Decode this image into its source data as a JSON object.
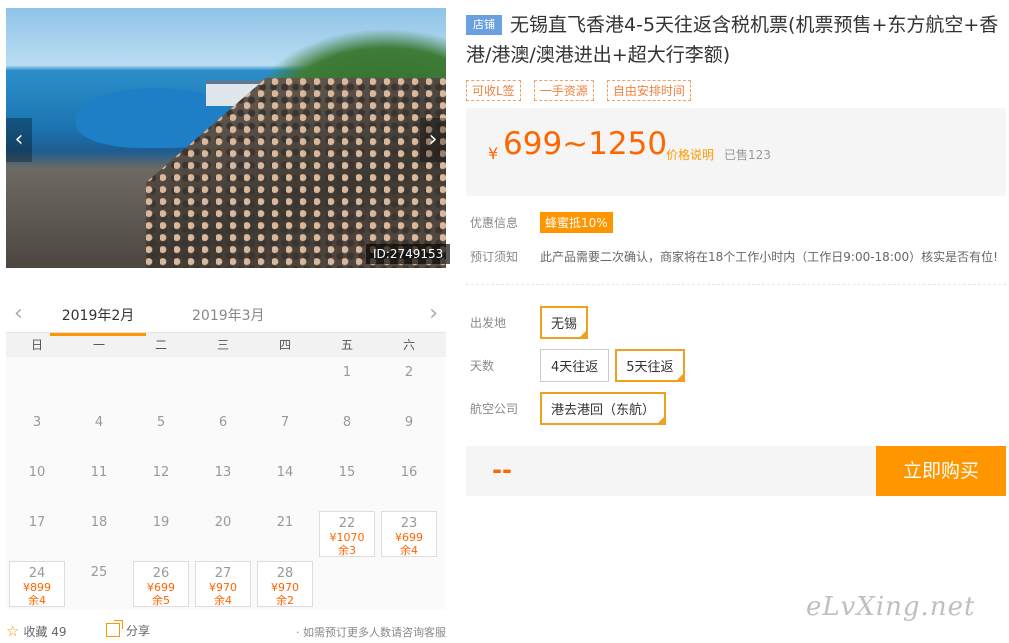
{
  "gallery": {
    "image_id": "ID:2749153",
    "prev": "‹",
    "next": "›"
  },
  "calendar": {
    "prev": "‹",
    "next": "›",
    "active_month": "2019年2月",
    "next_month": "2019年3月",
    "weekdays": [
      "日",
      "一",
      "二",
      "三",
      "四",
      "五",
      "六"
    ],
    "days": [
      {
        "d": ""
      },
      {
        "d": ""
      },
      {
        "d": ""
      },
      {
        "d": ""
      },
      {
        "d": ""
      },
      {
        "d": "1"
      },
      {
        "d": "2"
      },
      {
        "d": "3"
      },
      {
        "d": "4"
      },
      {
        "d": "5"
      },
      {
        "d": "6"
      },
      {
        "d": "7"
      },
      {
        "d": "8"
      },
      {
        "d": "9"
      },
      {
        "d": "10"
      },
      {
        "d": "11"
      },
      {
        "d": "12"
      },
      {
        "d": "13"
      },
      {
        "d": "14"
      },
      {
        "d": "15"
      },
      {
        "d": "16"
      },
      {
        "d": "17"
      },
      {
        "d": "18"
      },
      {
        "d": "19"
      },
      {
        "d": "20"
      },
      {
        "d": "21"
      },
      {
        "d": "22",
        "price": "¥1070",
        "stock": "余3"
      },
      {
        "d": "23",
        "price": "¥699",
        "stock": "余4"
      },
      {
        "d": "24",
        "price": "¥899",
        "stock": "余4"
      },
      {
        "d": "25"
      },
      {
        "d": "26",
        "price": "¥699",
        "stock": "余5"
      },
      {
        "d": "27",
        "price": "¥970",
        "stock": "余4"
      },
      {
        "d": "28",
        "price": "¥970",
        "stock": "余2"
      }
    ]
  },
  "footer": {
    "favorite_label": "收藏 49",
    "share_label": "分享",
    "note": "· 如需预订更多人数请咨询客服"
  },
  "product": {
    "shop_badge": "店铺",
    "title": "无锡直飞香港4-5天往返含税机票(机票预售+东方航空+香港/港澳/澳港进出+超大行李额)",
    "tags": [
      "可收L签",
      "一手资源",
      "自由安排时间"
    ],
    "yen": "¥",
    "price": "699~1250",
    "price_explain": "价格说明",
    "sold": "已售123"
  },
  "info": {
    "discount_label": "优惠信息",
    "discount": "蜂蜜抵10%",
    "notice_label": "预订须知",
    "notice": "此产品需要二次确认，商家将在18个工作小时内（工作日9:00-18:00）核实是否有位!"
  },
  "options": {
    "departure_label": "出发地",
    "departure": "无锡",
    "days_label": "天数",
    "days_opt1": "4天往返",
    "days_opt2": "5天往返",
    "airline_label": "航空公司",
    "airline": "港去港回（东航）"
  },
  "buy": {
    "total": "--",
    "button": "立即购买"
  },
  "watermark": "eLvXing.net"
}
